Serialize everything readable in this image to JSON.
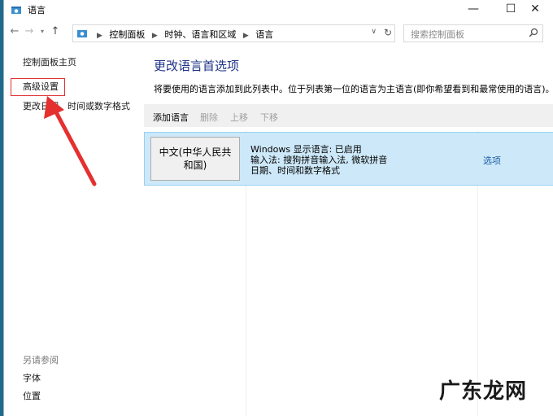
{
  "window": {
    "title": "语言"
  },
  "window_buttons": {
    "minimize": "—",
    "maximize": "☐",
    "close": "✕"
  },
  "address": {
    "crumbs": [
      "控制面板",
      "时钟、语言和区域",
      "语言"
    ]
  },
  "search": {
    "placeholder": "搜索控制面板"
  },
  "sidebar": {
    "home": "控制面板主页",
    "advanced": "高级设置",
    "date_time": "更改日期、时间或数字格式",
    "see_also": "另请参阅",
    "fonts": "字体",
    "location": "位置"
  },
  "main": {
    "title": "更改语言首选项",
    "description": "将要使用的语言添加到此列表中。位于列表第一位的语言为主语言(即你希望看到和最常使用的语言)。",
    "toolbar": {
      "add": "添加语言",
      "remove": "删除",
      "up": "上移",
      "down": "下移"
    },
    "languages": [
      {
        "name_line1": "中文(中华人民共",
        "name_line2": "和国)",
        "info": [
          "Windows 显示语言: 已启用",
          "输入法: 搜狗拼音输入法, 微软拼音",
          "日期、时间和数字格式"
        ],
        "options": "选项"
      }
    ]
  },
  "annotation": {
    "arrow_color": "#e53030",
    "highlight_color": "#e03030"
  },
  "watermark": "广东龙网"
}
